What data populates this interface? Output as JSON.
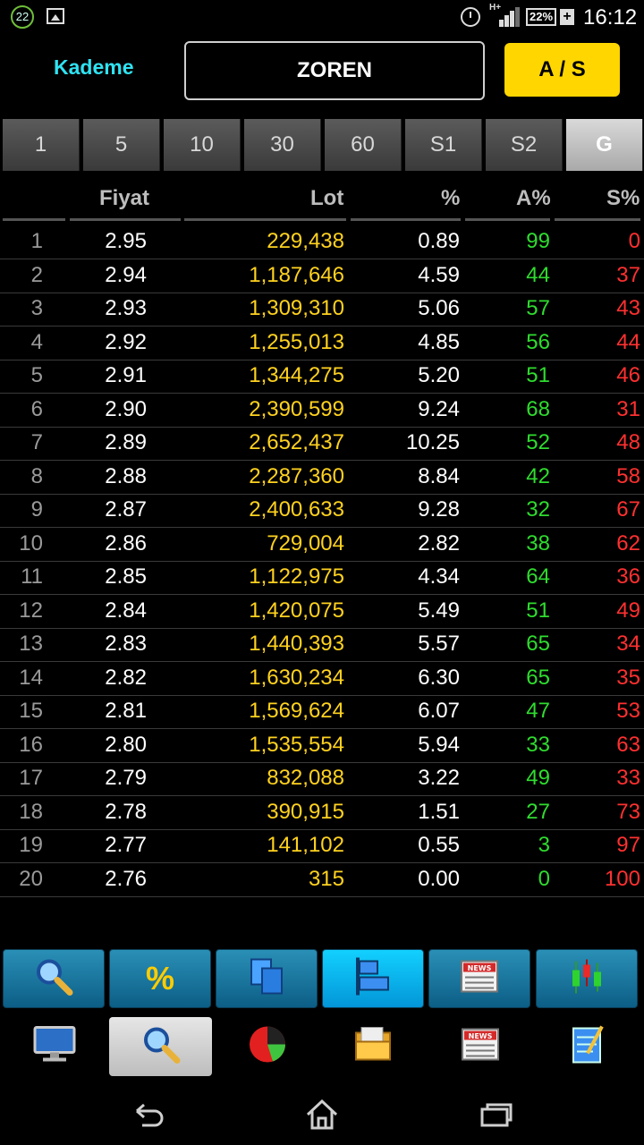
{
  "statusbar": {
    "notification_count": "22",
    "battery": "22%",
    "network": "H+",
    "time": "16:12"
  },
  "header": {
    "title": "Kademe",
    "symbol": "ZOREN",
    "side_button": "A / S"
  },
  "tabs": [
    "1",
    "5",
    "10",
    "30",
    "60",
    "S1",
    "S2",
    "G"
  ],
  "active_tab": "G",
  "table": {
    "columns": [
      "Fiyat",
      "Lot",
      "%",
      "A%",
      "S%"
    ],
    "rows": [
      {
        "idx": "1",
        "fiyat": "2.95",
        "lot": "229,438",
        "pct": "0.89",
        "a": "99",
        "s": "0"
      },
      {
        "idx": "2",
        "fiyat": "2.94",
        "lot": "1,187,646",
        "pct": "4.59",
        "a": "44",
        "s": "37"
      },
      {
        "idx": "3",
        "fiyat": "2.93",
        "lot": "1,309,310",
        "pct": "5.06",
        "a": "57",
        "s": "43"
      },
      {
        "idx": "4",
        "fiyat": "2.92",
        "lot": "1,255,013",
        "pct": "4.85",
        "a": "56",
        "s": "44"
      },
      {
        "idx": "5",
        "fiyat": "2.91",
        "lot": "1,344,275",
        "pct": "5.20",
        "a": "51",
        "s": "46"
      },
      {
        "idx": "6",
        "fiyat": "2.90",
        "lot": "2,390,599",
        "pct": "9.24",
        "a": "68",
        "s": "31"
      },
      {
        "idx": "7",
        "fiyat": "2.89",
        "lot": "2,652,437",
        "pct": "10.25",
        "a": "52",
        "s": "48"
      },
      {
        "idx": "8",
        "fiyat": "2.88",
        "lot": "2,287,360",
        "pct": "8.84",
        "a": "42",
        "s": "58"
      },
      {
        "idx": "9",
        "fiyat": "2.87",
        "lot": "2,400,633",
        "pct": "9.28",
        "a": "32",
        "s": "67"
      },
      {
        "idx": "10",
        "fiyat": "2.86",
        "lot": "729,004",
        "pct": "2.82",
        "a": "38",
        "s": "62"
      },
      {
        "idx": "11",
        "fiyat": "2.85",
        "lot": "1,122,975",
        "pct": "4.34",
        "a": "64",
        "s": "36"
      },
      {
        "idx": "12",
        "fiyat": "2.84",
        "lot": "1,420,075",
        "pct": "5.49",
        "a": "51",
        "s": "49"
      },
      {
        "idx": "13",
        "fiyat": "2.83",
        "lot": "1,440,393",
        "pct": "5.57",
        "a": "65",
        "s": "34"
      },
      {
        "idx": "14",
        "fiyat": "2.82",
        "lot": "1,630,234",
        "pct": "6.30",
        "a": "65",
        "s": "35"
      },
      {
        "idx": "15",
        "fiyat": "2.81",
        "lot": "1,569,624",
        "pct": "6.07",
        "a": "47",
        "s": "53"
      },
      {
        "idx": "16",
        "fiyat": "2.80",
        "lot": "1,535,554",
        "pct": "5.94",
        "a": "33",
        "s": "63"
      },
      {
        "idx": "17",
        "fiyat": "2.79",
        "lot": "832,088",
        "pct": "3.22",
        "a": "49",
        "s": "33"
      },
      {
        "idx": "18",
        "fiyat": "2.78",
        "lot": "390,915",
        "pct": "1.51",
        "a": "27",
        "s": "73"
      },
      {
        "idx": "19",
        "fiyat": "2.77",
        "lot": "141,102",
        "pct": "0.55",
        "a": "3",
        "s": "97"
      },
      {
        "idx": "20",
        "fiyat": "2.76",
        "lot": "315",
        "pct": "0.00",
        "a": "0",
        "s": "100"
      }
    ]
  },
  "toolbar": {
    "items": [
      {
        "icon": "search-icon"
      },
      {
        "icon": "percent-icon",
        "label": "%"
      },
      {
        "icon": "copy-icon"
      },
      {
        "icon": "depth-icon",
        "active": true
      },
      {
        "icon": "news-icon",
        "label": "NEWS"
      },
      {
        "icon": "candlestick-icon"
      }
    ]
  },
  "bottom_nav": {
    "items": [
      {
        "icon": "monitor-icon"
      },
      {
        "icon": "search-icon",
        "active": true
      },
      {
        "icon": "pie-chart-icon"
      },
      {
        "icon": "folder-icon"
      },
      {
        "icon": "news-icon",
        "label": "NEWS"
      },
      {
        "icon": "notepad-icon"
      }
    ]
  },
  "colors": {
    "accent_cyan": "#2fe3f3",
    "accent_yellow": "#ffd600",
    "lot_yellow": "#ffd21f",
    "buy_green": "#2fdc2f",
    "sell_red": "#ff3030"
  }
}
